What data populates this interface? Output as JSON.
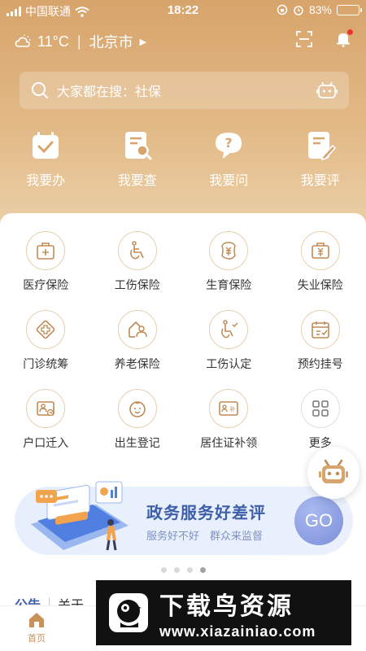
{
  "status_bar": {
    "carrier": "中国联通",
    "time": "18:22",
    "battery": "83%",
    "battery_level": 0.83
  },
  "weather": {
    "temperature": "11°C",
    "city": "北京市"
  },
  "search": {
    "placeholder": "大家都在搜：社保"
  },
  "quick_actions": [
    {
      "label": "我要办",
      "icon": "calendar-check-icon"
    },
    {
      "label": "我要查",
      "icon": "document-search-icon"
    },
    {
      "label": "我要问",
      "icon": "question-bubble-icon"
    },
    {
      "label": "我要评",
      "icon": "document-edit-icon"
    }
  ],
  "services": [
    {
      "label": "医疗保险",
      "icon": "medical-kit-icon"
    },
    {
      "label": "工伤保险",
      "icon": "wheelchair-icon"
    },
    {
      "label": "生育保险",
      "icon": "yuan-shield-icon"
    },
    {
      "label": "失业保险",
      "icon": "briefcase-yuan-icon"
    },
    {
      "label": "门诊统筹",
      "icon": "clinic-cross-icon"
    },
    {
      "label": "养老保险",
      "icon": "elderly-house-icon"
    },
    {
      "label": "工伤认定",
      "icon": "injury-confirm-icon"
    },
    {
      "label": "预约挂号",
      "icon": "appointment-icon"
    },
    {
      "label": "户口迁入",
      "icon": "household-card-icon"
    },
    {
      "label": "出生登记",
      "icon": "baby-face-icon"
    },
    {
      "label": "居住证补领",
      "icon": "residence-card-icon"
    },
    {
      "label": "更多",
      "icon": "grid-more-icon"
    }
  ],
  "banner": {
    "title": "政务服务好差评",
    "subtitle": "服务好不好　群众来监督",
    "button": "GO"
  },
  "notice": {
    "tag": "公告",
    "text": "关于"
  },
  "tabs": [
    {
      "label": "首页",
      "icon": "home-icon",
      "active": true
    }
  ],
  "watermark": {
    "title": "下载鸟资源",
    "url": "www.xiazainiao.com"
  },
  "colors": {
    "accent": "#c8925a",
    "header": "#d7a46b",
    "banner_text": "#3d5ea9",
    "icon_line": "#c08a54"
  }
}
